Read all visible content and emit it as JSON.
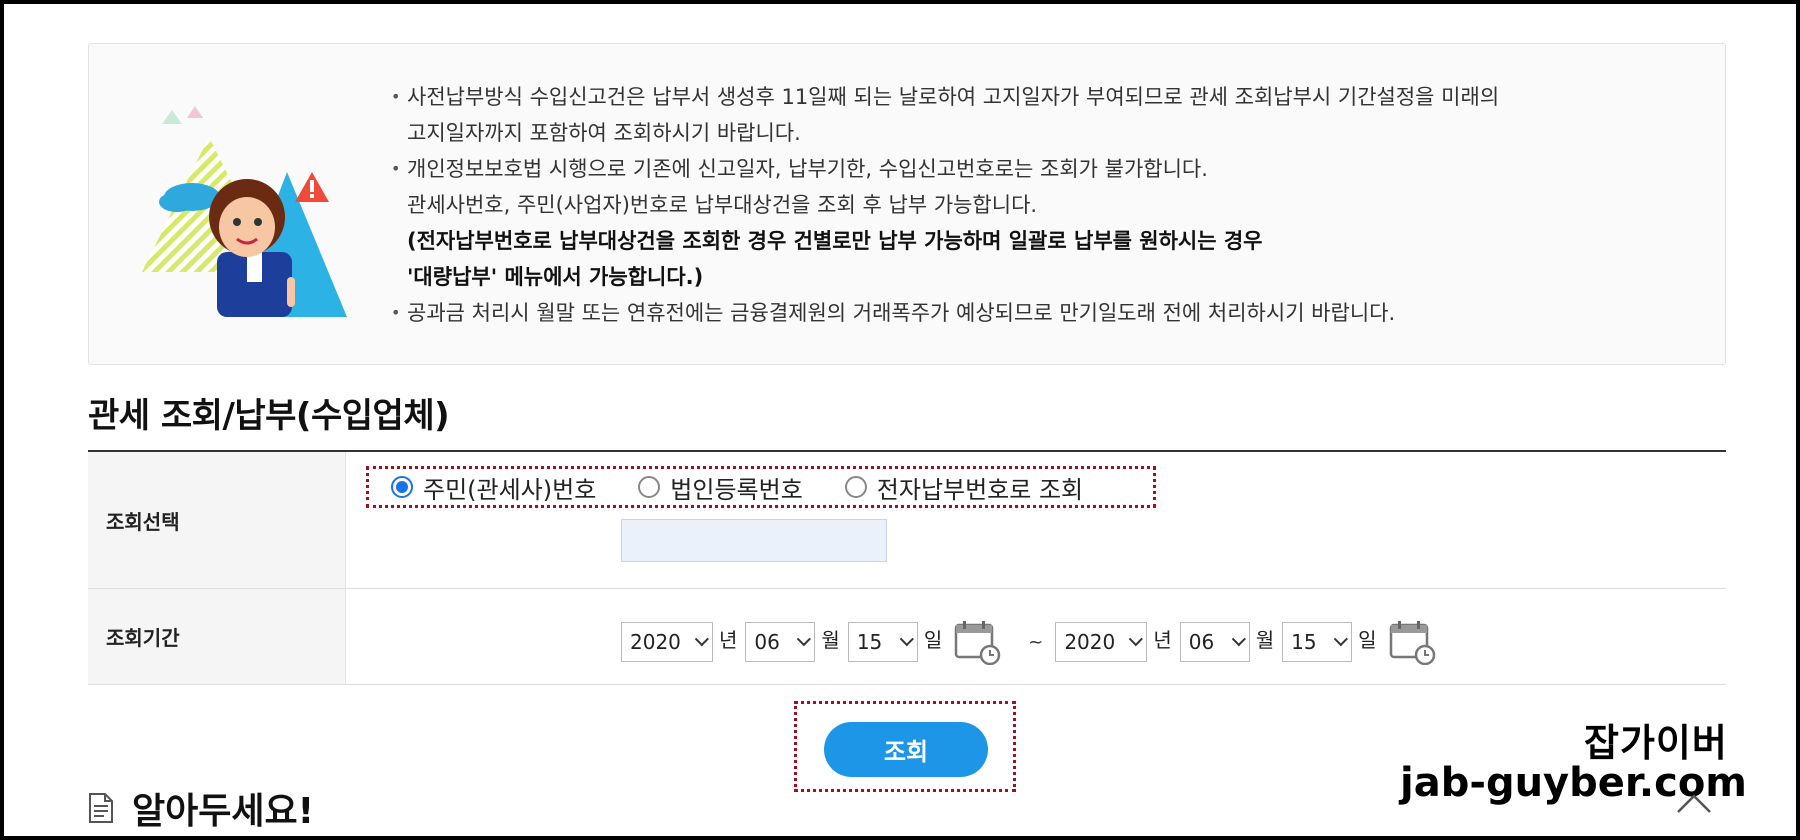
{
  "notice": {
    "items": [
      {
        "lines": [
          "사전납부방식 수입신고건은 납부서 생성후 11일째 되는 날로하여 고지일자가 부여되므로 관세 조회납부시 기간설정을 미래의",
          "고지일자까지 포함하여 조회하시기 바랍니다."
        ]
      },
      {
        "lines": [
          "개인정보보호법 시행으로 기존에 신고일자, 납부기한, 수입신고번호로는 조회가 불가합니다.",
          "관세사번호, 주민(사업자)번호로 납부대상건을 조회 후 납부 가능합니다."
        ],
        "bold_lines": [
          "(전자납부번호로 납부대상건을 조회한 경우 건별로만 납부 가능하며 일괄로 납부를 원하시는 경우",
          "'대량납부' 메뉴에서 가능합니다.)"
        ]
      },
      {
        "lines": [
          "공과금 처리시 월말 또는 연휴전에는 금융결제원의 거래폭주가 예상되므로 만기일도래 전에 처리하시기 바랍니다."
        ]
      }
    ]
  },
  "section_title": "관세 조회/납부(수입업체)",
  "form": {
    "lookup_label": "조회선택",
    "radio_options": [
      "주민(관세사)번호",
      "법인등록번호",
      "전자납부번호로 조회"
    ],
    "selected_index": 0,
    "id_value": "",
    "period_label": "조회기간",
    "start": {
      "year": "2020",
      "month": "06",
      "day": "15"
    },
    "end": {
      "year": "2020",
      "month": "06",
      "day": "15"
    },
    "unit_year": "년",
    "unit_month": "월",
    "unit_day": "일",
    "tilde": "~"
  },
  "search_button": "조회",
  "notice_heading": "알아두세요!",
  "watermark": {
    "line1": "잡가이버",
    "line2": "jab-guyber.com"
  },
  "colors": {
    "accent": "#1e96e8",
    "highlight_border": "#a01020",
    "radio_checked": "#1a73e8"
  }
}
